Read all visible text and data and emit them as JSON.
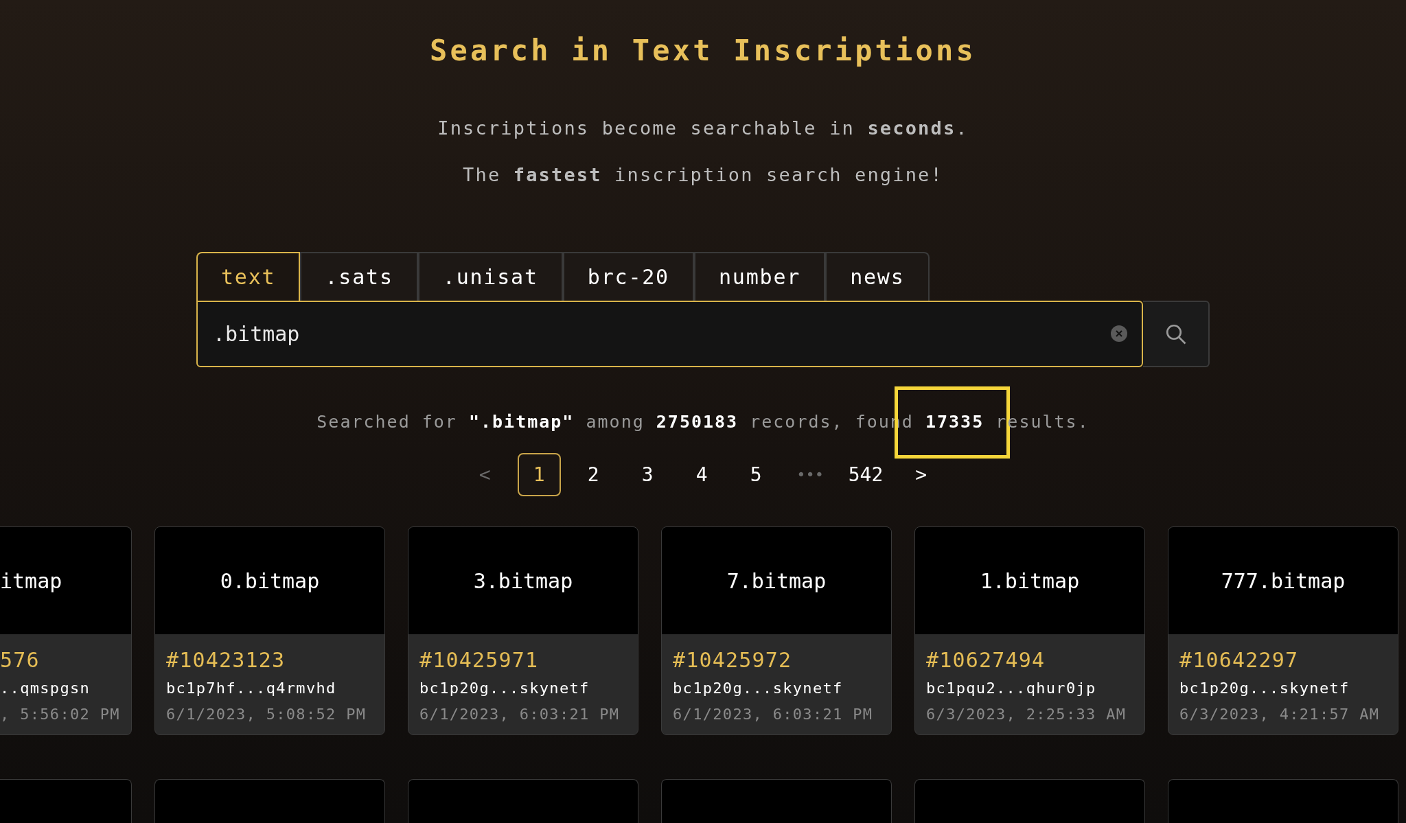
{
  "header": {
    "title": "Search in Text Inscriptions",
    "taglines": [
      "Inscriptions become searchable in **seconds**.",
      "The **fastest** inscription search engine!"
    ]
  },
  "tabs": [
    {
      "label": "text",
      "selected": true
    },
    {
      "label": ".sats",
      "selected": false
    },
    {
      "label": ".unisat",
      "selected": false
    },
    {
      "label": "brc-20",
      "selected": false
    },
    {
      "label": "number",
      "selected": false
    },
    {
      "label": "news",
      "selected": false
    }
  ],
  "search": {
    "value": ".bitmap"
  },
  "summary": [
    {
      "text": "Searched for ",
      "strong": false,
      "highlighted": false
    },
    {
      "text": "\".bitmap\"",
      "strong": true,
      "highlighted": false
    },
    {
      "text": " among ",
      "strong": false,
      "highlighted": false
    },
    {
      "text": "2750183",
      "strong": true,
      "highlighted": false
    },
    {
      "text": " records, found ",
      "strong": false,
      "highlighted": false
    },
    {
      "text": "17335",
      "strong": true,
      "highlighted": true
    },
    {
      "text": " results.",
      "strong": false,
      "highlighted": false
    }
  ],
  "pagination": {
    "prev": "<",
    "next": ">",
    "pages": [
      {
        "label": "1",
        "kind": "page",
        "selected": true
      },
      {
        "label": "2",
        "kind": "page",
        "selected": false
      },
      {
        "label": "3",
        "kind": "page",
        "selected": false
      },
      {
        "label": "4",
        "kind": "page",
        "selected": false
      },
      {
        "label": "5",
        "kind": "page",
        "selected": false
      },
      {
        "label": "•••",
        "kind": "ellipsis",
        "selected": false
      },
      {
        "label": "542",
        "kind": "page",
        "selected": false
      }
    ]
  },
  "cards": [
    {
      "kind": "clipped",
      "title": "itmap",
      "number": "576",
      "address": "..qmspgsn",
      "date": ", 5:56:02 PM"
    },
    {
      "kind": "full",
      "title": "0.bitmap",
      "number": "#10423123",
      "address": "bc1p7hf...q4rmvhd",
      "date": "6/1/2023, 5:08:52 PM"
    },
    {
      "kind": "full",
      "title": "3.bitmap",
      "number": "#10425971",
      "address": "bc1p20g...skynetf",
      "date": "6/1/2023, 6:03:21 PM"
    },
    {
      "kind": "full",
      "title": "7.bitmap",
      "number": "#10425972",
      "address": "bc1p20g...skynetf",
      "date": "6/1/2023, 6:03:21 PM"
    },
    {
      "kind": "full",
      "title": "1.bitmap",
      "number": "#10627494",
      "address": "bc1pqu2...qhur0jp",
      "date": "6/3/2023, 2:25:33 AM"
    },
    {
      "kind": "full",
      "title": "777.bitmap",
      "number": "#10642297",
      "address": "bc1p20g...skynetf",
      "date": "6/3/2023, 4:21:57 AM"
    }
  ],
  "next_row": [
    {
      "kind": "clipped"
    },
    {
      "kind": "full"
    },
    {
      "kind": "full"
    },
    {
      "kind": "full"
    },
    {
      "kind": "full"
    },
    {
      "kind": "full"
    }
  ]
}
